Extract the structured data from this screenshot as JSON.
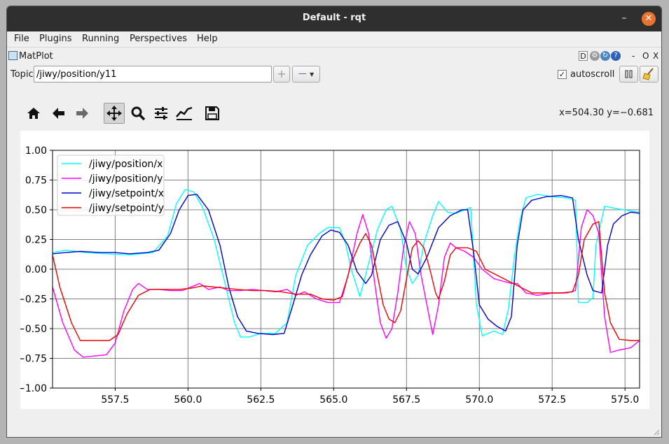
{
  "window": {
    "title": "Default - rqt",
    "min_glyph": "–",
    "close_glyph": "✕"
  },
  "menu": {
    "file": "File",
    "plugins": "Plugins",
    "running": "Running",
    "perspectives": "Perspectives",
    "help": "Help"
  },
  "plugin": {
    "title": "MatPlot",
    "d_label": "D",
    "min_label": "-",
    "float_label": "O",
    "close_label": "X"
  },
  "topic": {
    "label": "Topic",
    "value": "/jiwy/position/y11",
    "add_glyph": "+",
    "remove_glyph": "—"
  },
  "autoscroll": {
    "label": "autoscroll",
    "checked": true,
    "check_glyph": "✓"
  },
  "toolbar": {
    "icons": [
      "home-icon",
      "back-icon",
      "forward-icon",
      "pan-icon",
      "zoom-icon",
      "subplots-icon",
      "customize-icon",
      "save-icon"
    ],
    "active": "pan-icon"
  },
  "coords": "x=504.30 y=−0.681",
  "colors": {
    "pos_x": "#00ffff",
    "pos_y": "#ff00ff",
    "set_x": "#0000cc",
    "set_y": "#ee0000",
    "grid": "#808080"
  },
  "chart_data": {
    "type": "line",
    "title": "",
    "xlabel": "",
    "ylabel": "",
    "xlim": [
      555.35,
      575.5
    ],
    "ylim": [
      -1.0,
      1.0
    ],
    "grid": true,
    "legend_position": "top-left",
    "x_ticks": [
      557.5,
      560.0,
      562.5,
      565.0,
      567.5,
      570.0,
      572.5,
      575.0
    ],
    "x_tick_labels": [
      "557.5",
      "560.0",
      "562.5",
      "565.0",
      "567.5",
      "570.0",
      "572.5",
      "575.0"
    ],
    "y_ticks": [
      1.0,
      0.75,
      0.5,
      0.25,
      0.0,
      -0.25,
      -0.5,
      -0.75,
      -1.0
    ],
    "y_tick_labels": [
      "1.00",
      "0.75",
      "0.50",
      "0.25",
      "0.00",
      "−0.25",
      "−0.50",
      "−0.75",
      "−1.00"
    ],
    "series": [
      {
        "name": "/jiwy/position/x",
        "color": "#00ffff",
        "points": [
          [
            555.35,
            0.14
          ],
          [
            555.8,
            0.16
          ],
          [
            556.5,
            0.14
          ],
          [
            557.2,
            0.13
          ],
          [
            558.0,
            0.12
          ],
          [
            558.8,
            0.14
          ],
          [
            559.3,
            0.28
          ],
          [
            559.6,
            0.55
          ],
          [
            559.9,
            0.67
          ],
          [
            560.2,
            0.65
          ],
          [
            560.5,
            0.52
          ],
          [
            560.9,
            0.25
          ],
          [
            561.3,
            -0.15
          ],
          [
            561.6,
            -0.45
          ],
          [
            561.8,
            -0.57
          ],
          [
            562.1,
            -0.57
          ],
          [
            562.5,
            -0.54
          ],
          [
            563.0,
            -0.54
          ],
          [
            563.4,
            -0.45
          ],
          [
            563.7,
            -0.05
          ],
          [
            564.1,
            0.2
          ],
          [
            564.5,
            0.3
          ],
          [
            564.8,
            0.35
          ],
          [
            565.2,
            0.35
          ],
          [
            565.4,
            0.22
          ],
          [
            565.6,
            0.0
          ],
          [
            565.9,
            -0.23
          ],
          [
            566.2,
            0.05
          ],
          [
            566.5,
            0.33
          ],
          [
            566.8,
            0.5
          ],
          [
            567.0,
            0.53
          ],
          [
            567.3,
            0.33
          ],
          [
            567.5,
            0.0
          ],
          [
            567.7,
            -0.12
          ],
          [
            567.9,
            -0.05
          ],
          [
            568.1,
            0.22
          ],
          [
            568.4,
            0.45
          ],
          [
            568.6,
            0.57
          ],
          [
            568.9,
            0.48
          ],
          [
            569.2,
            0.47
          ],
          [
            569.5,
            0.5
          ],
          [
            569.7,
            0.52
          ],
          [
            569.9,
            -0.3
          ],
          [
            570.1,
            -0.56
          ],
          [
            570.5,
            -0.52
          ],
          [
            570.8,
            -0.55
          ],
          [
            571.0,
            -0.33
          ],
          [
            571.2,
            0.1
          ],
          [
            571.4,
            0.42
          ],
          [
            571.6,
            0.6
          ],
          [
            572.0,
            0.63
          ],
          [
            572.5,
            0.61
          ],
          [
            573.0,
            0.6
          ],
          [
            573.3,
            0.58
          ],
          [
            573.4,
            -0.28
          ],
          [
            573.7,
            -0.28
          ],
          [
            573.9,
            -0.24
          ],
          [
            574.0,
            0.2
          ],
          [
            574.3,
            0.53
          ],
          [
            574.7,
            0.51
          ],
          [
            575.2,
            0.49
          ],
          [
            575.5,
            0.48
          ]
        ]
      },
      {
        "name": "/jiwy/position/y",
        "color": "#ff00ff",
        "points": [
          [
            555.35,
            -0.15
          ],
          [
            555.7,
            -0.45
          ],
          [
            556.1,
            -0.68
          ],
          [
            556.4,
            -0.74
          ],
          [
            556.8,
            -0.73
          ],
          [
            557.2,
            -0.72
          ],
          [
            557.5,
            -0.62
          ],
          [
            557.8,
            -0.35
          ],
          [
            558.1,
            -0.17
          ],
          [
            558.3,
            -0.12
          ],
          [
            558.6,
            -0.17
          ],
          [
            559.0,
            -0.17
          ],
          [
            559.4,
            -0.18
          ],
          [
            559.8,
            -0.18
          ],
          [
            560.0,
            -0.16
          ],
          [
            560.4,
            -0.12
          ],
          [
            560.7,
            -0.17
          ],
          [
            561.1,
            -0.15
          ],
          [
            561.4,
            -0.18
          ],
          [
            561.8,
            -0.18
          ],
          [
            562.2,
            -0.17
          ],
          [
            562.6,
            -0.18
          ],
          [
            563.0,
            -0.19
          ],
          [
            563.4,
            -0.17
          ],
          [
            563.7,
            -0.22
          ],
          [
            564.0,
            -0.19
          ],
          [
            564.4,
            -0.25
          ],
          [
            564.8,
            -0.28
          ],
          [
            565.2,
            -0.28
          ],
          [
            565.5,
            -0.05
          ],
          [
            565.8,
            0.3
          ],
          [
            566.0,
            0.46
          ],
          [
            566.2,
            0.3
          ],
          [
            566.4,
            -0.1
          ],
          [
            566.6,
            -0.45
          ],
          [
            566.8,
            -0.58
          ],
          [
            567.0,
            -0.5
          ],
          [
            567.2,
            -0.2
          ],
          [
            567.4,
            0.18
          ],
          [
            567.6,
            0.4
          ],
          [
            567.8,
            0.3
          ],
          [
            568.0,
            -0.05
          ],
          [
            568.2,
            -0.3
          ],
          [
            568.4,
            -0.55
          ],
          [
            568.6,
            -0.3
          ],
          [
            568.8,
            0.1
          ],
          [
            569.0,
            0.22
          ],
          [
            569.2,
            0.18
          ],
          [
            569.5,
            0.15
          ],
          [
            569.8,
            0.1
          ],
          [
            570.1,
            0.0
          ],
          [
            570.5,
            -0.08
          ],
          [
            570.8,
            -0.1
          ],
          [
            571.1,
            -0.12
          ],
          [
            571.3,
            -0.12
          ],
          [
            571.6,
            -0.2
          ],
          [
            572.0,
            -0.22
          ],
          [
            572.5,
            -0.2
          ],
          [
            573.0,
            -0.2
          ],
          [
            573.3,
            -0.18
          ],
          [
            573.5,
            0.35
          ],
          [
            573.7,
            0.5
          ],
          [
            573.9,
            0.45
          ],
          [
            574.1,
            0.3
          ],
          [
            574.3,
            -0.4
          ],
          [
            574.5,
            -0.7
          ],
          [
            574.8,
            -0.68
          ],
          [
            575.2,
            -0.66
          ],
          [
            575.5,
            -0.6
          ]
        ]
      },
      {
        "name": "/jiwy/setpoint/x",
        "color": "#0000cc",
        "points": [
          [
            555.35,
            0.13
          ],
          [
            555.8,
            0.14
          ],
          [
            556.3,
            0.15
          ],
          [
            557.0,
            0.14
          ],
          [
            557.5,
            0.14
          ],
          [
            558.0,
            0.13
          ],
          [
            558.6,
            0.14
          ],
          [
            559.0,
            0.16
          ],
          [
            559.4,
            0.3
          ],
          [
            559.7,
            0.5
          ],
          [
            560.0,
            0.62
          ],
          [
            560.3,
            0.63
          ],
          [
            560.7,
            0.5
          ],
          [
            561.1,
            0.2
          ],
          [
            561.4,
            -0.15
          ],
          [
            561.7,
            -0.4
          ],
          [
            562.0,
            -0.52
          ],
          [
            562.4,
            -0.54
          ],
          [
            562.9,
            -0.55
          ],
          [
            563.3,
            -0.54
          ],
          [
            563.6,
            -0.3
          ],
          [
            563.9,
            -0.05
          ],
          [
            564.2,
            0.12
          ],
          [
            564.6,
            0.28
          ],
          [
            564.9,
            0.33
          ],
          [
            565.2,
            0.31
          ],
          [
            565.5,
            0.2
          ],
          [
            565.8,
            -0.02
          ],
          [
            566.1,
            -0.12
          ],
          [
            566.3,
            -0.05
          ],
          [
            566.6,
            0.25
          ],
          [
            566.9,
            0.37
          ],
          [
            567.2,
            0.4
          ],
          [
            567.5,
            0.22
          ],
          [
            567.7,
            0.0
          ],
          [
            567.9,
            -0.04
          ],
          [
            568.2,
            0.1
          ],
          [
            568.6,
            0.35
          ],
          [
            569.0,
            0.45
          ],
          [
            569.4,
            0.5
          ],
          [
            569.6,
            0.5
          ],
          [
            569.8,
            0.15
          ],
          [
            570.0,
            -0.3
          ],
          [
            570.3,
            -0.42
          ],
          [
            570.6,
            -0.48
          ],
          [
            570.9,
            -0.52
          ],
          [
            571.1,
            -0.4
          ],
          [
            571.3,
            0.2
          ],
          [
            571.5,
            0.5
          ],
          [
            571.8,
            0.58
          ],
          [
            572.3,
            0.61
          ],
          [
            572.8,
            0.62
          ],
          [
            573.2,
            0.6
          ],
          [
            573.4,
            0.25
          ],
          [
            573.7,
            -0.05
          ],
          [
            573.9,
            -0.18
          ],
          [
            574.2,
            -0.2
          ],
          [
            574.4,
            0.2
          ],
          [
            574.6,
            0.38
          ],
          [
            574.9,
            0.45
          ],
          [
            575.2,
            0.48
          ],
          [
            575.5,
            0.47
          ]
        ]
      },
      {
        "name": "/jiwy/setpoint/y",
        "color": "#ee0000",
        "points": [
          [
            555.35,
            0.12
          ],
          [
            555.6,
            -0.15
          ],
          [
            556.0,
            -0.45
          ],
          [
            556.3,
            -0.6
          ],
          [
            556.8,
            -0.6
          ],
          [
            557.3,
            -0.6
          ],
          [
            557.6,
            -0.55
          ],
          [
            557.9,
            -0.38
          ],
          [
            558.3,
            -0.22
          ],
          [
            558.7,
            -0.17
          ],
          [
            559.2,
            -0.17
          ],
          [
            559.7,
            -0.17
          ],
          [
            560.1,
            -0.16
          ],
          [
            560.5,
            -0.14
          ],
          [
            560.9,
            -0.15
          ],
          [
            561.3,
            -0.16
          ],
          [
            561.7,
            -0.17
          ],
          [
            562.2,
            -0.18
          ],
          [
            562.7,
            -0.18
          ],
          [
            563.2,
            -0.19
          ],
          [
            563.7,
            -0.21
          ],
          [
            564.2,
            -0.21
          ],
          [
            564.6,
            -0.25
          ],
          [
            565.0,
            -0.26
          ],
          [
            565.3,
            -0.23
          ],
          [
            565.6,
            0.05
          ],
          [
            565.9,
            0.22
          ],
          [
            566.1,
            0.3
          ],
          [
            566.3,
            0.2
          ],
          [
            566.5,
            -0.05
          ],
          [
            566.7,
            -0.3
          ],
          [
            566.9,
            -0.42
          ],
          [
            567.1,
            -0.45
          ],
          [
            567.3,
            -0.35
          ],
          [
            567.5,
            -0.08
          ],
          [
            567.7,
            0.18
          ],
          [
            567.9,
            0.24
          ],
          [
            568.1,
            0.18
          ],
          [
            568.3,
            0.0
          ],
          [
            568.5,
            -0.2
          ],
          [
            568.6,
            -0.25
          ],
          [
            568.8,
            -0.1
          ],
          [
            569.0,
            0.12
          ],
          [
            569.2,
            0.18
          ],
          [
            569.6,
            0.18
          ],
          [
            569.9,
            0.15
          ],
          [
            570.2,
            0.0
          ],
          [
            570.6,
            -0.05
          ],
          [
            571.0,
            -0.1
          ],
          [
            571.4,
            -0.15
          ],
          [
            571.8,
            -0.2
          ],
          [
            572.3,
            -0.2
          ],
          [
            572.8,
            -0.2
          ],
          [
            573.2,
            -0.19
          ],
          [
            573.4,
            -0.05
          ],
          [
            573.6,
            0.25
          ],
          [
            573.9,
            0.38
          ],
          [
            574.1,
            0.4
          ],
          [
            574.3,
            -0.2
          ],
          [
            574.5,
            -0.45
          ],
          [
            574.8,
            -0.59
          ],
          [
            575.2,
            -0.6
          ],
          [
            575.5,
            -0.6
          ]
        ]
      }
    ]
  }
}
